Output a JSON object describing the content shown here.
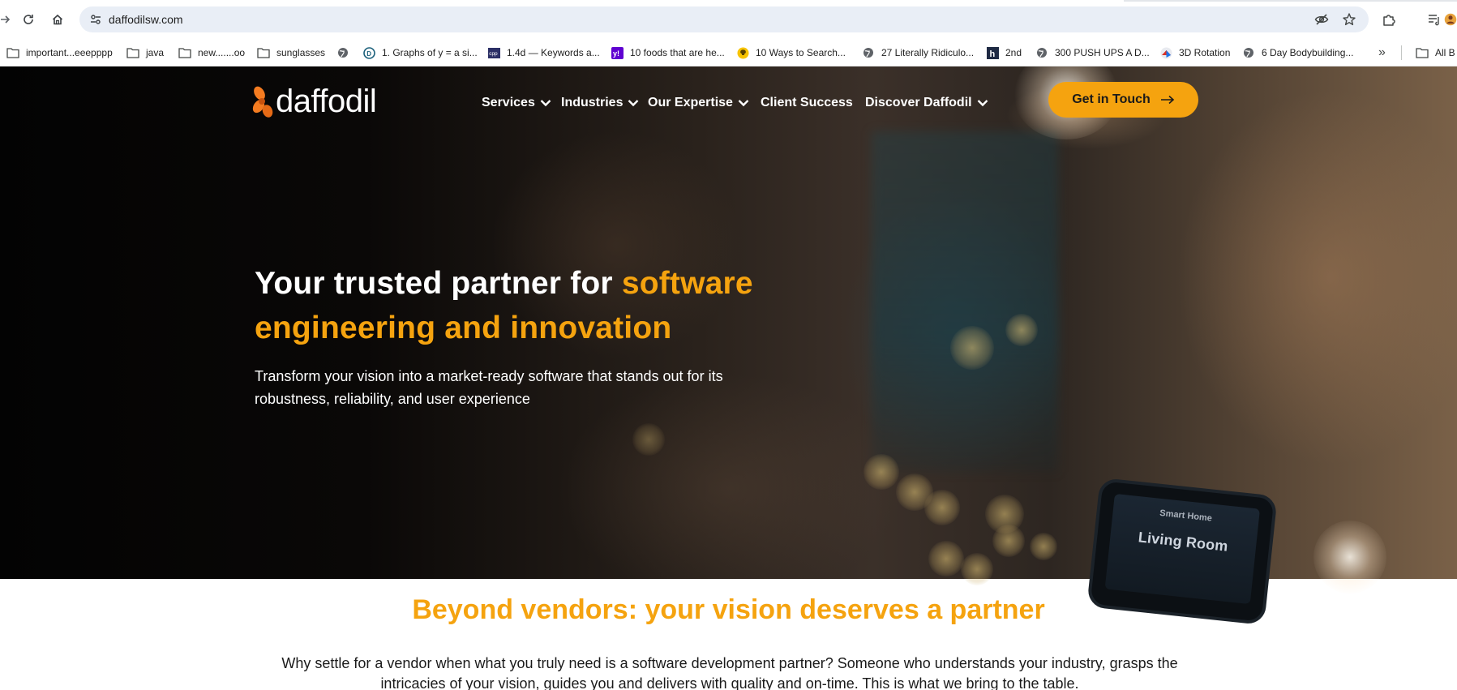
{
  "browser": {
    "url": "daffodilsw.com",
    "bookmarks": [
      {
        "label": "important...eeepppp",
        "icon": "folder-icon"
      },
      {
        "label": "java",
        "icon": "folder-icon"
      },
      {
        "label": "new.......oo",
        "icon": "folder-icon"
      },
      {
        "label": "sunglasses",
        "icon": "folder-icon"
      },
      {
        "label": "",
        "icon": "globe-icon"
      },
      {
        "label": "1. Graphs of y = a si...",
        "icon": "site-d-icon"
      },
      {
        "label": "1.4d — Keywords a...",
        "icon": "site-cpp-icon"
      },
      {
        "label": "10 foods that are he...",
        "icon": "yahoo-icon"
      },
      {
        "label": "10 Ways to Search...",
        "icon": "bulb-icon"
      },
      {
        "label": "27 Literally Ridiculo...",
        "icon": "globe-icon"
      },
      {
        "label": "2nd",
        "icon": "site-h-icon"
      },
      {
        "label": "300 PUSH UPS A D...",
        "icon": "globe-icon"
      },
      {
        "label": "3D Rotation",
        "icon": "rotation-icon"
      },
      {
        "label": "6 Day Bodybuilding...",
        "icon": "globe-icon"
      }
    ],
    "overflow_label": "»",
    "all_bookmarks_label": "All B"
  },
  "site": {
    "logo_text": "daffodil",
    "nav": [
      {
        "label": "Services",
        "has_dropdown": true
      },
      {
        "label": "Industries",
        "has_dropdown": true
      },
      {
        "label": "Our Expertise",
        "has_dropdown": true
      },
      {
        "label": "Client Success",
        "has_dropdown": false
      },
      {
        "label": "Discover Daffodil",
        "has_dropdown": true
      }
    ],
    "cta_label": "Get in Touch",
    "hero": {
      "title_plain": "Your trusted partner for ",
      "title_accent": "software engineering and innovation",
      "subtitle": "Transform your vision into a market-ready software that stands out for its robustness, reliability, and user experience",
      "phone_line1": "Smart Home",
      "phone_line2": "Living Room"
    },
    "section": {
      "title": "Beyond vendors: your vision deserves a partner",
      "body": "Why settle for a vendor when what you truly need is a software development partner? Someone who understands your industry, grasps the intricacies of your vision, guides you and delivers with quality and on-time. This is what we bring to the table."
    },
    "colors": {
      "accent": "#f5a30f",
      "hero_text": "#ffffff",
      "body_text": "#1a1a1a"
    }
  }
}
